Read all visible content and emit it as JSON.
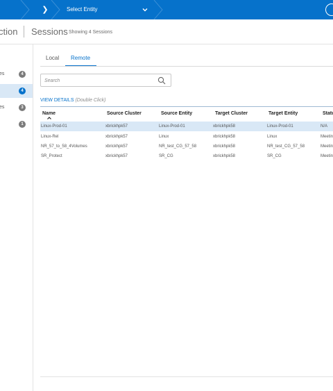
{
  "topbar": {
    "entity_selector_label": "Select Entity",
    "colors": {
      "bar": "#0672cb"
    }
  },
  "header": {
    "title_prefix": "ction",
    "title": "Sessions",
    "session_count_label": "Showing 4 Sessions"
  },
  "leftnav": {
    "items": [
      {
        "label": "es",
        "count": "4",
        "active": false
      },
      {
        "label": "",
        "count": "4",
        "active": true
      },
      {
        "label": "es",
        "count": "3",
        "active": false
      },
      {
        "label": "",
        "count": "1",
        "active": false
      }
    ]
  },
  "tabs": [
    {
      "label": "Local",
      "selected": false
    },
    {
      "label": "Remote",
      "selected": true
    }
  ],
  "search": {
    "placeholder": "Search",
    "icon": "search-icon"
  },
  "view_details": {
    "link": "VIEW DETAILS",
    "hint": "(Double Click)"
  },
  "table": {
    "columns": [
      "Name",
      "Source Cluster",
      "Source Entity",
      "Target Cluster",
      "Target Entity",
      "Statu"
    ],
    "sort_column": "Name",
    "rows": [
      {
        "cells": [
          "Linux-Prod-01",
          "xbrickhpk57",
          "Linux-Prod-01",
          "xbrickhpk58",
          "Linux-Prod-01",
          "N/A"
        ],
        "selected": true
      },
      {
        "cells": [
          "Linux-Rel",
          "xbrickhpk57",
          "Linux",
          "xbrickhpk58",
          "Linux",
          "Meetin"
        ],
        "selected": false
      },
      {
        "cells": [
          "NR_57_to_58_4Volumes",
          "xbrickhpk57",
          "NR_test_CG_57_58",
          "xbrickhpk58",
          "NR_test_CG_57_58",
          "Meetin"
        ],
        "selected": false
      },
      {
        "cells": [
          "SR_Protect",
          "xbrickhpk57",
          "SR_CG",
          "xbrickhpk58",
          "SR_CG",
          "Meetin"
        ],
        "selected": false
      }
    ]
  }
}
